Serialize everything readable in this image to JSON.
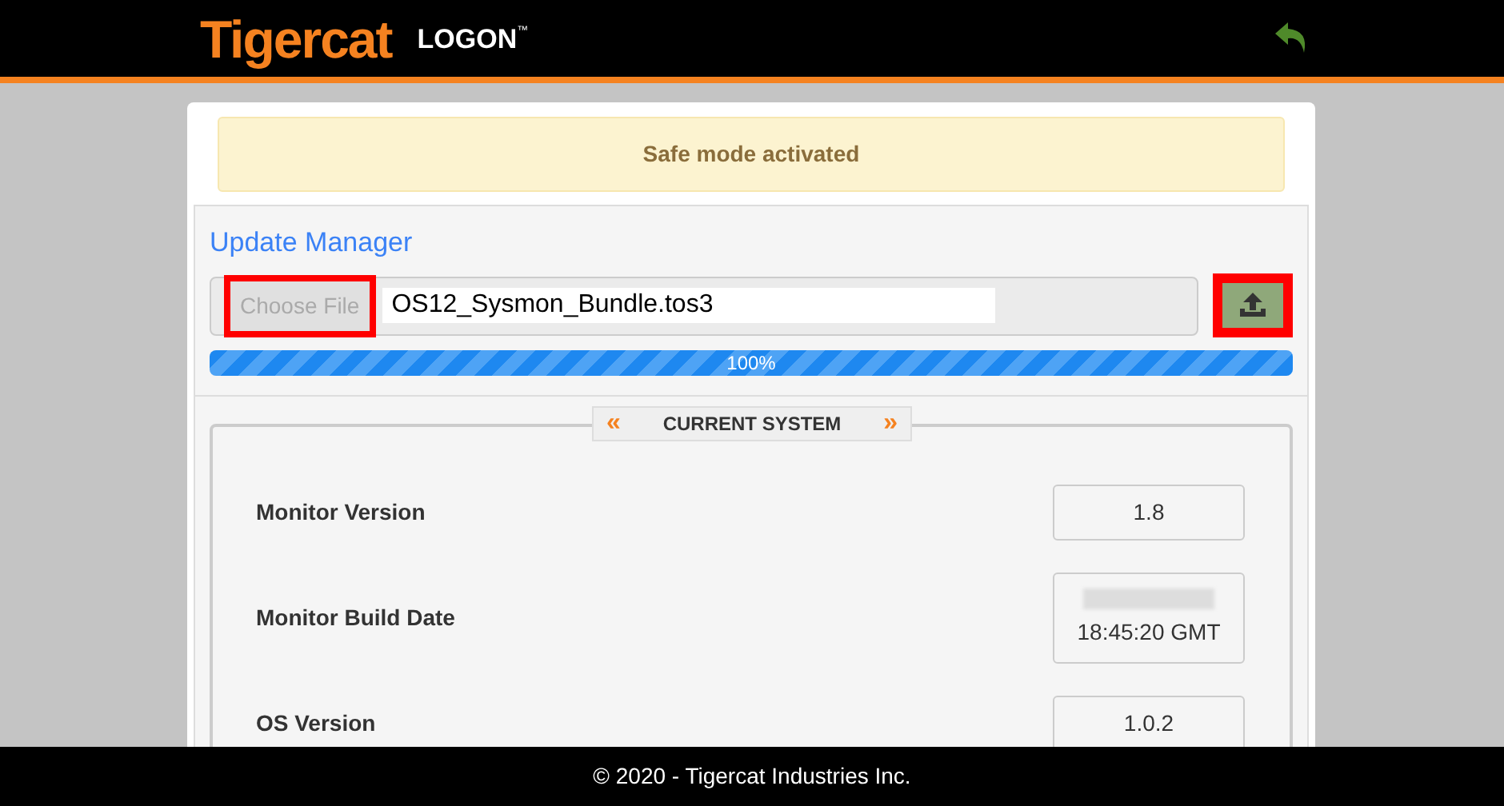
{
  "header": {
    "brand": "Tigercat",
    "product": "LOGON",
    "trademark": "™"
  },
  "alert": {
    "text": "Safe mode activated"
  },
  "update_manager": {
    "title": "Update Manager",
    "choose_button": "Choose File",
    "file_name": "OS12_Sysmon_Bundle.tos3",
    "highlighted": true,
    "progress": {
      "level": 1.0,
      "label": "100%"
    }
  },
  "current_system": {
    "legend": "CURRENT SYSTEM",
    "left_mark": "«",
    "right_mark": "»",
    "rows": [
      {
        "label": "Monitor Version",
        "value": "1.8",
        "redacted": false
      },
      {
        "label": "Monitor Build Date",
        "value": "18:45:20 GMT",
        "redacted": true
      },
      {
        "label": "OS Version",
        "value": "1.0.2",
        "redacted": false
      }
    ]
  },
  "footer": {
    "text": "© 2020 - Tigercat Industries Inc."
  }
}
